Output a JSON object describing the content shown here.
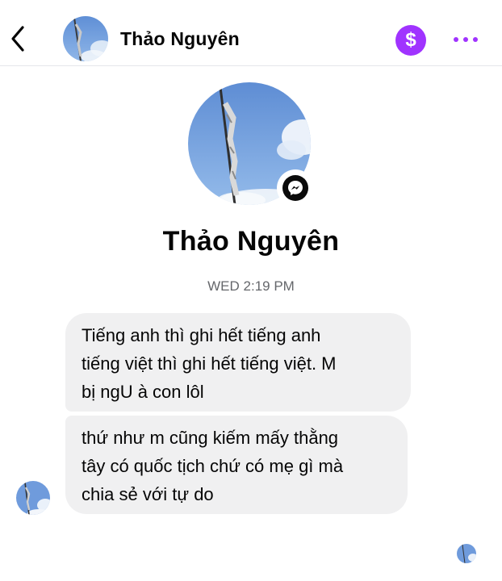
{
  "header": {
    "back_icon": "chevron-left-icon",
    "contact_name": "Thảo Nguyên",
    "payment_symbol": "$",
    "payment_icon": "dollar-circle-icon",
    "more_icon": "more-dots-icon",
    "accent_color": "#a033ff"
  },
  "profile": {
    "name": "Thảo Nguyên",
    "badge_icon": "messenger-icon"
  },
  "conversation": {
    "timestamp": "WED 2:19 PM",
    "messages": [
      {
        "lines": [
          "Tiếng anh thì ghi hết tiếng anh",
          "tiếng việt thì ghi hết tiếng việt. M",
          "bị ngU à con lôl"
        ]
      },
      {
        "lines": [
          "thứ như m cũng kiếm mấy thằng",
          "tây có quốc tịch chứ có mẹ gì mà",
          "chia sẻ với tự do"
        ]
      }
    ],
    "bubble_color": "#f0f0f1"
  }
}
